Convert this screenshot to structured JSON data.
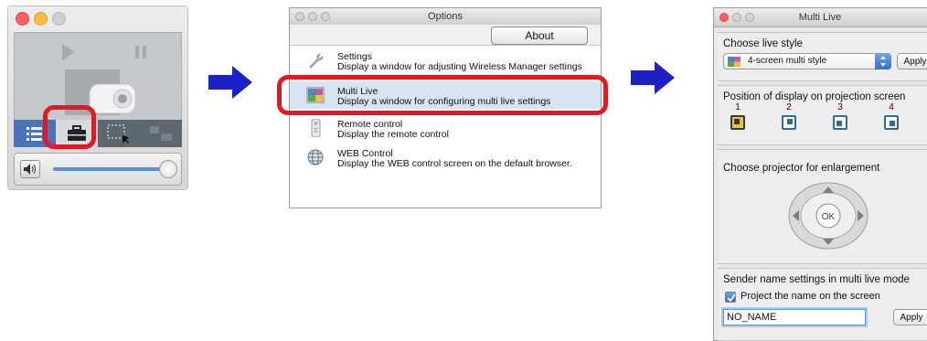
{
  "options_window": {
    "title": "Options",
    "about_button": "About",
    "items": [
      {
        "title": "Settings",
        "description": "Display a window for adjusting Wireless Manager settings"
      },
      {
        "title": "Multi Live",
        "description": "Display a window for configuring multi live settings"
      },
      {
        "title": "Remote control",
        "description": "Display the remote control"
      },
      {
        "title": "WEB Control",
        "description": "Display the WEB control screen on the default browser."
      }
    ]
  },
  "multi_live_window": {
    "title": "Multi Live",
    "live_style": {
      "label": "Choose live style",
      "selected": "4-screen multi style",
      "apply": "Apply"
    },
    "position": {
      "label": "Position of display on projection screen",
      "numbers": [
        "1",
        "2",
        "3",
        "4"
      ]
    },
    "projector": {
      "label": "Choose projector for enlargement",
      "ok": "OK"
    },
    "sender": {
      "label": "Sender name settings in multi live mode",
      "checkbox_label": "Project the name on the screen",
      "checked": true,
      "name_value": "NO_NAME",
      "apply": "Apply"
    }
  },
  "colors": {
    "arrow": "#1b20c7",
    "highlight": "#e01923",
    "toolbar": "#5d6770",
    "selected_row": "#d9e4f2"
  }
}
